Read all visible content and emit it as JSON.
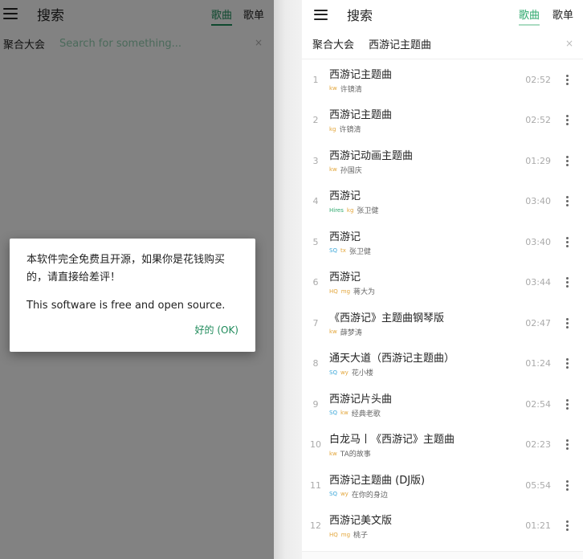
{
  "left": {
    "title": "搜索",
    "tabs": [
      {
        "label": "歌曲",
        "active": true
      },
      {
        "label": "歌单",
        "active": false
      }
    ],
    "source_label": "聚合大会",
    "search_placeholder": "Search for something...",
    "clear_icon": "×",
    "dialog": {
      "message_cn": "本软件完全免费且开源，如果你是花钱购买的，请直接给差评！",
      "message_en": "This software is free and open source.",
      "ok_label": "好的 (OK)"
    }
  },
  "right": {
    "title": "搜索",
    "tabs": [
      {
        "label": "歌曲",
        "active": true
      },
      {
        "label": "歌单",
        "active": false
      }
    ],
    "source_label": "聚合大会",
    "query": "西游记主题曲",
    "clear_icon": "×",
    "songs": [
      {
        "num": "1",
        "name": "西游记主题曲",
        "badges": [
          "kw"
        ],
        "artist": "许镜清",
        "duration": "02:52"
      },
      {
        "num": "2",
        "name": "西游记主题曲",
        "badges": [
          "kg"
        ],
        "artist": "许镜清",
        "duration": "02:52"
      },
      {
        "num": "3",
        "name": "西游记动画主题曲",
        "badges": [
          "kw"
        ],
        "artist": "孙国庆",
        "duration": "01:29"
      },
      {
        "num": "4",
        "name": "西游记",
        "badges": [
          "Hires",
          "kg"
        ],
        "artist": "张卫健",
        "duration": "03:40"
      },
      {
        "num": "5",
        "name": "西游记",
        "badges": [
          "SQ",
          "tx"
        ],
        "artist": "张卫健",
        "duration": "03:40"
      },
      {
        "num": "6",
        "name": "西游记",
        "badges": [
          "HQ",
          "mg"
        ],
        "artist": "蒋大为",
        "duration": "03:44"
      },
      {
        "num": "7",
        "name": "《西游记》主题曲钢琴版",
        "badges": [
          "kw"
        ],
        "artist": "薛梦涛",
        "duration": "02:47"
      },
      {
        "num": "8",
        "name": "通天大道（西游记主题曲）",
        "badges": [
          "SQ",
          "wy"
        ],
        "artist": "花小楼",
        "duration": "01:24"
      },
      {
        "num": "9",
        "name": "西游记片头曲",
        "badges": [
          "SQ",
          "kw"
        ],
        "artist": "经典老歌",
        "duration": "02:54"
      },
      {
        "num": "10",
        "name": "白龙马丨《西游记》主题曲",
        "badges": [
          "kw"
        ],
        "artist": "TA的故事",
        "duration": "02:23"
      },
      {
        "num": "11",
        "name": "西游记主题曲 (DJ版)",
        "badges": [
          "SQ",
          "wy"
        ],
        "artist": "在你的身边",
        "duration": "05:54"
      },
      {
        "num": "12",
        "name": "西游记美文版",
        "badges": [
          "HQ",
          "mg"
        ],
        "artist": "桃子",
        "duration": "01:21"
      }
    ]
  },
  "colors": {
    "accent": "#2ea86d",
    "badge_orange": "#e3a63b",
    "badge_blue": "#3aa6d8"
  }
}
